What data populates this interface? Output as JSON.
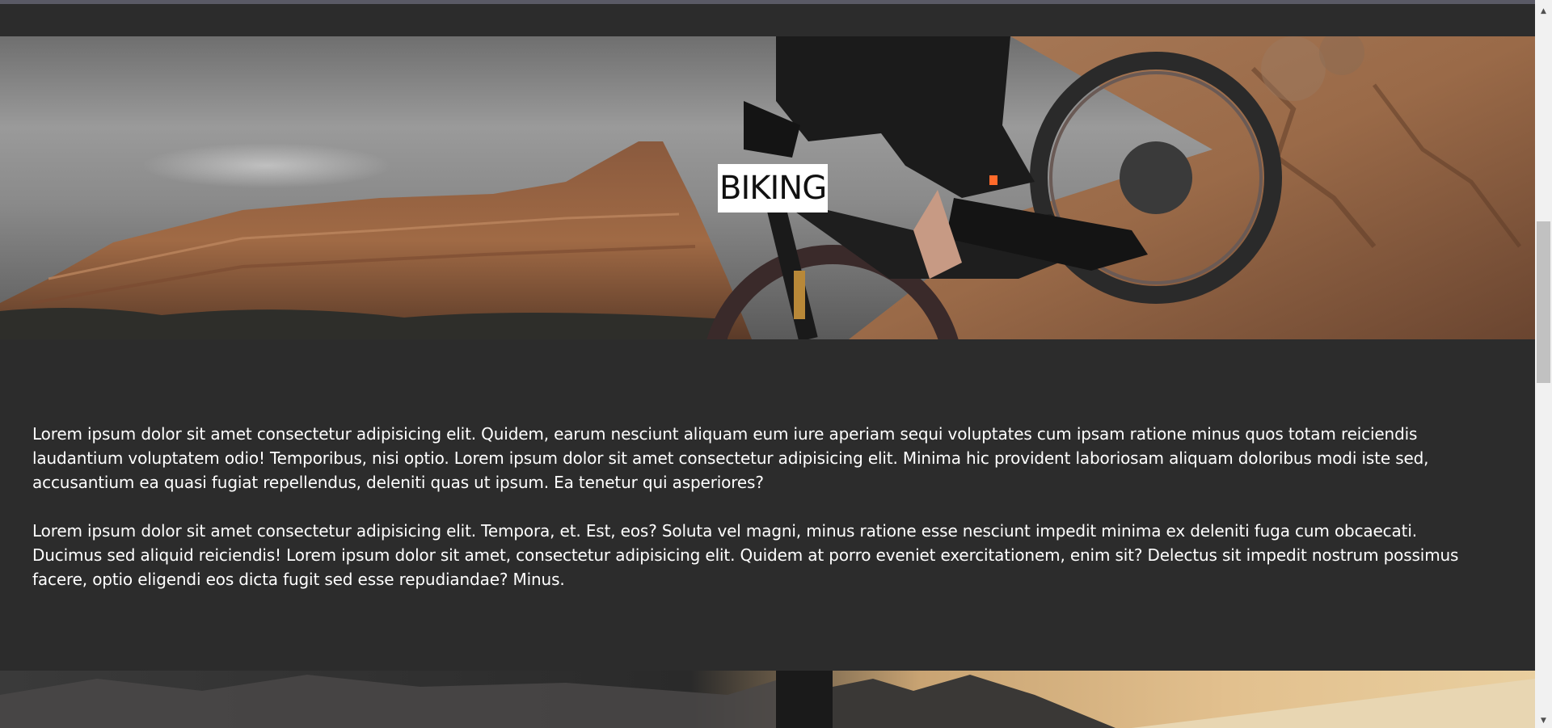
{
  "hero": {
    "title": "BIKING"
  },
  "content": {
    "paragraphs": [
      "Lorem ipsum dolor sit amet consectetur adipisicing elit. Quidem, earum nesciunt aliquam eum iure aperiam sequi voluptates cum ipsam ratione minus quos totam reiciendis laudantium voluptatem odio! Temporibus, nisi optio. Lorem ipsum dolor sit amet consectetur adipisicing elit. Minima hic provident laboriosam aliquam doloribus modi iste sed, accusantium ea quasi fugiat repellendus, deleniti quas ut ipsum. Ea tenetur qui asperiores?",
      "Lorem ipsum dolor sit amet consectetur adipisicing elit. Tempora, et. Est, eos? Soluta vel magni, minus ratione esse nesciunt impedit minima ex deleniti fuga cum obcaecati. Ducimus sed aliquid reiciendis! Lorem ipsum dolor sit amet, consectetur adipisicing elit. Quidem at porro eveniet exercitationem, enim sit? Delectus sit impedit nostrum possimus facere, optio eligendi eos dicta fugit sed esse repudiandae? Minus."
    ]
  },
  "scrollbar": {
    "up_icon": "chevron-up-icon",
    "down_icon": "chevron-down-icon",
    "position_fraction": 0.38
  },
  "colors": {
    "page_background": "#2c2c2c",
    "text": "#ffffff",
    "title_background": "#ffffff",
    "title_text": "#111111"
  }
}
